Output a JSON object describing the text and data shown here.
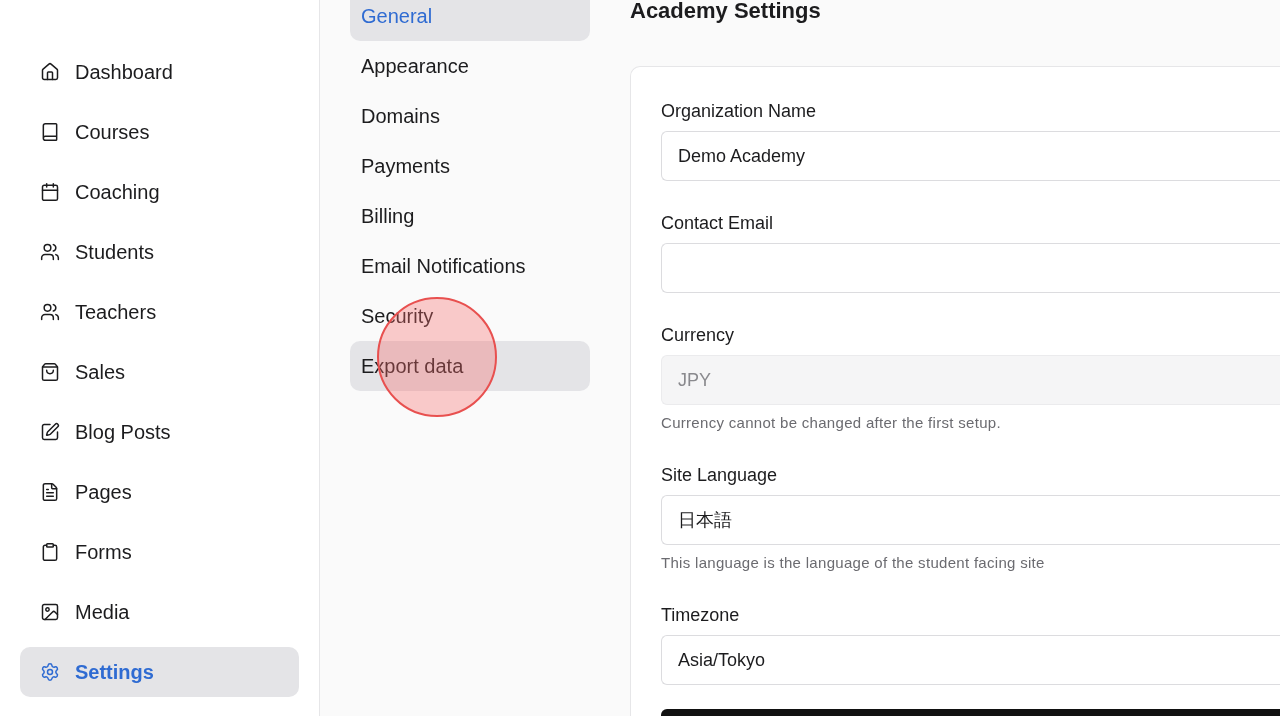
{
  "sidebar": {
    "items": [
      {
        "label": "Dashboard",
        "selected": false
      },
      {
        "label": "Courses",
        "selected": false
      },
      {
        "label": "Coaching",
        "selected": false
      },
      {
        "label": "Students",
        "selected": false
      },
      {
        "label": "Teachers",
        "selected": false
      },
      {
        "label": "Sales",
        "selected": false
      },
      {
        "label": "Blog Posts",
        "selected": false
      },
      {
        "label": "Pages",
        "selected": false
      },
      {
        "label": "Forms",
        "selected": false
      },
      {
        "label": "Media",
        "selected": false
      },
      {
        "label": "Settings",
        "selected": true
      }
    ]
  },
  "settings_nav": {
    "items": [
      {
        "label": "General",
        "selected": true,
        "hovered": false
      },
      {
        "label": "Appearance",
        "selected": false,
        "hovered": false
      },
      {
        "label": "Domains",
        "selected": false,
        "hovered": false
      },
      {
        "label": "Payments",
        "selected": false,
        "hovered": false
      },
      {
        "label": "Billing",
        "selected": false,
        "hovered": false
      },
      {
        "label": "Email Notifications",
        "selected": false,
        "hovered": false
      },
      {
        "label": "Security",
        "selected": false,
        "hovered": false
      },
      {
        "label": "Export data",
        "selected": false,
        "hovered": true
      }
    ]
  },
  "page": {
    "title": "Academy Settings"
  },
  "form": {
    "fields": [
      {
        "label": "Organization Name",
        "value": "Demo Academy",
        "disabled": false
      },
      {
        "label": "Contact Email",
        "disabled": false
      },
      {
        "label": "Currency",
        "value": "JPY",
        "disabled": true,
        "help": "Currency cannot be changed after the first setup."
      },
      {
        "label": "Site Language",
        "value": "日本語",
        "disabled": false,
        "help": "This language is the language of the student facing site"
      },
      {
        "label": "Timezone",
        "value": "Asia/Tokyo",
        "disabled": false
      }
    ]
  }
}
